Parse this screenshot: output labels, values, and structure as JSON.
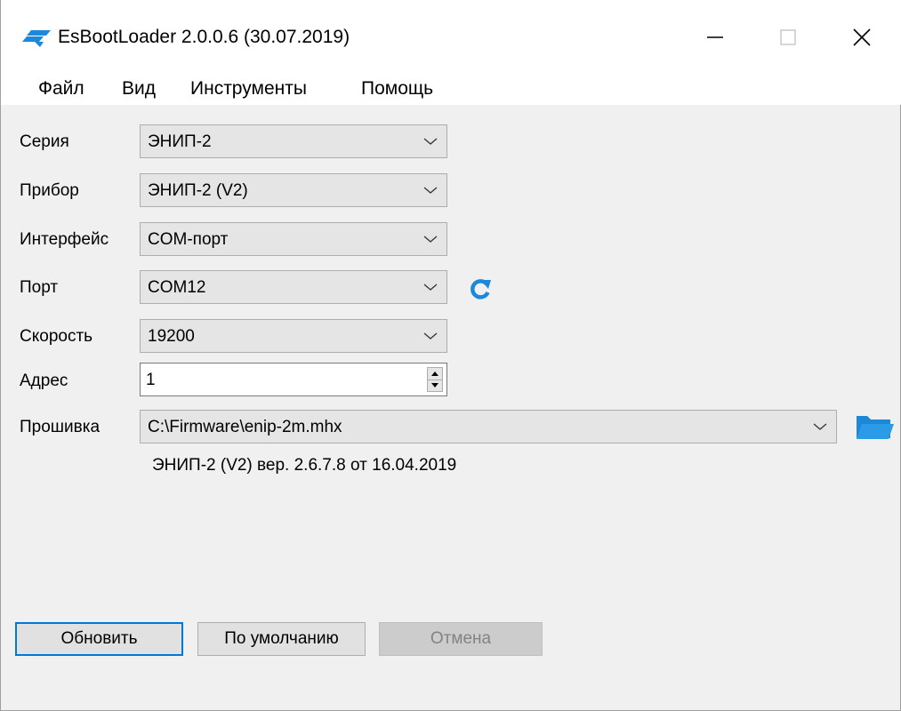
{
  "window": {
    "title": "EsBootLoader 2.0.0.6 (30.07.2019)"
  },
  "menu": [
    "Файл",
    "Вид",
    "Инструменты",
    "Помощь"
  ],
  "fields": {
    "series": {
      "label": "Серия",
      "value": "ЭНИП-2"
    },
    "device": {
      "label": "Прибор",
      "value": "ЭНИП-2 (V2)"
    },
    "interface": {
      "label": "Интерфейс",
      "value": "COM-порт"
    },
    "port": {
      "label": "Порт",
      "value": "COM12"
    },
    "speed": {
      "label": "Скорость",
      "value": "19200"
    },
    "address": {
      "label": "Адрес",
      "value": "1"
    },
    "firmware": {
      "label": "Прошивка",
      "value": "C:\\Firmware\\enip-2m.mhx"
    }
  },
  "firmware_info": "ЭНИП-2 (V2) вер. 2.6.7.8 от 16.04.2019",
  "buttons": {
    "update": "Обновить",
    "default": "По умолчанию",
    "cancel": "Отмена"
  },
  "colors": {
    "accent": "#0078d7",
    "icon_blue": "#1e88d8",
    "background": "#f0f0f0"
  },
  "icons": [
    "app-logo-icon",
    "minimize-icon",
    "maximize-icon",
    "close-icon",
    "chevron-down-icon",
    "refresh-icon",
    "folder-icon",
    "spin-up-icon",
    "spin-down-icon"
  ]
}
